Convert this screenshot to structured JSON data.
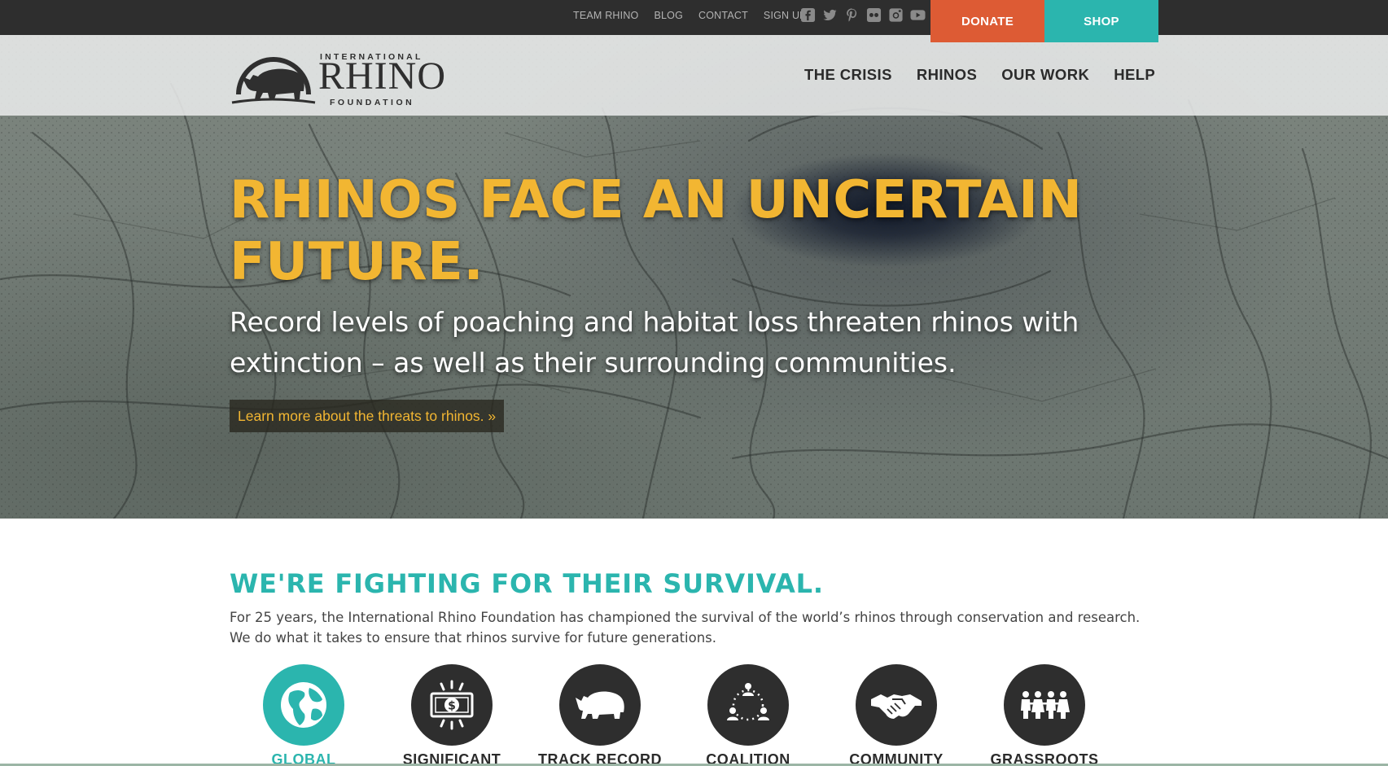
{
  "top_nav": {
    "links": [
      "TEAM RHINO",
      "BLOG",
      "CONTACT",
      "SIGN UP"
    ],
    "social_icons": [
      "facebook-icon",
      "twitter-icon",
      "pinterest-icon",
      "flickr-icon",
      "instagram-icon",
      "youtube-icon"
    ],
    "donate_label": "DONATE",
    "shop_label": "SHOP"
  },
  "logo": {
    "line1": "INTERNATIONAL",
    "line2": "RHINO",
    "line3": "FOUNDATION"
  },
  "main_nav": [
    "THE CRISIS",
    "RHINOS",
    "OUR WORK",
    "HELP"
  ],
  "hero": {
    "headline": "RHINOS FACE AN UNCERTAIN FUTURE.",
    "subhead": "Record levels of poaching and habitat loss threaten rhinos with extinction – as well as their surrounding communities.",
    "cta": "Learn more about the threats to rhinos. »"
  },
  "mission": {
    "title": "WE'RE FIGHTING FOR THEIR SURVIVAL.",
    "text_line1": "For 25 years, the International Rhino Foundation has championed the survival of the world’s rhinos through conservation and research.",
    "text_line2": "We do what it takes to ensure that rhinos survive for future generations."
  },
  "features": [
    {
      "label": "GLOBAL",
      "icon": "globe-icon",
      "active": true
    },
    {
      "label": "SIGNIFICANT",
      "icon": "money-icon",
      "active": false
    },
    {
      "label": "TRACK RECORD",
      "icon": "rhino-icon",
      "active": false
    },
    {
      "label": "COALITION",
      "icon": "network-icon",
      "active": false
    },
    {
      "label": "COMMUNITY",
      "icon": "handshake-icon",
      "active": false
    },
    {
      "label": "GRASSROOTS",
      "icon": "people-icon",
      "active": false
    }
  ],
  "colors": {
    "accent_teal": "#2bb5ae",
    "donate_orange": "#dd5b34",
    "headline_gold": "#f2b632",
    "dark_bar": "#2e2e2e"
  }
}
